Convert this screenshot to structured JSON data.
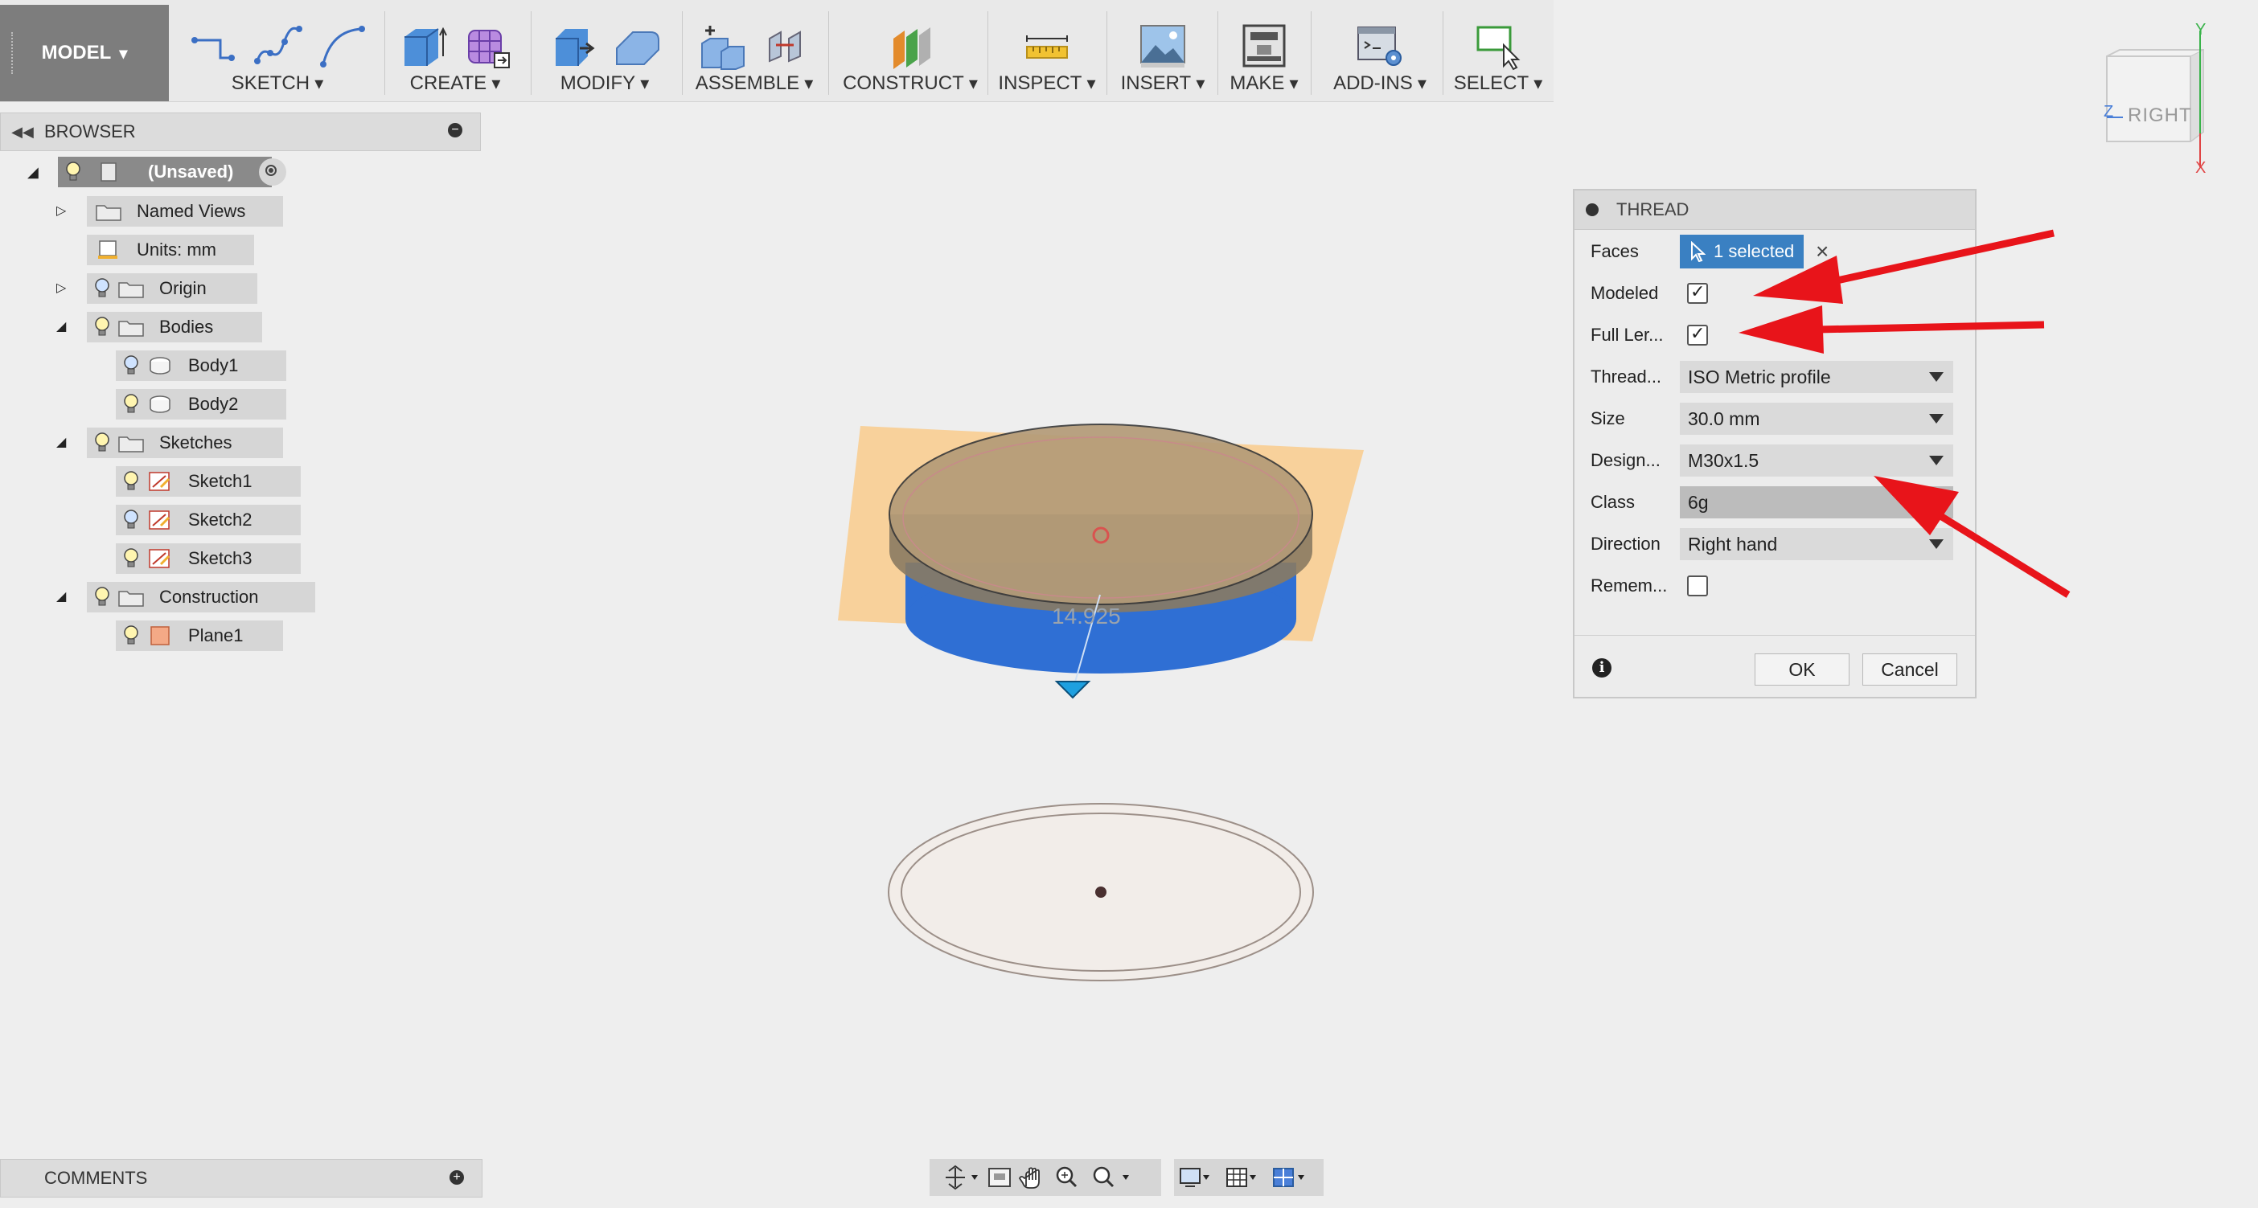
{
  "toolbar": {
    "workspace": "MODEL",
    "groups": [
      {
        "label": "SKETCH"
      },
      {
        "label": "CREATE"
      },
      {
        "label": "MODIFY"
      },
      {
        "label": "ASSEMBLE"
      },
      {
        "label": "CONSTRUCT"
      },
      {
        "label": "INSPECT"
      },
      {
        "label": "INSERT"
      },
      {
        "label": "MAKE"
      },
      {
        "label": "ADD-INS"
      },
      {
        "label": "SELECT"
      }
    ]
  },
  "browser": {
    "title": "BROWSER",
    "root": "(Unsaved)",
    "items": [
      {
        "label": "Named Views"
      },
      {
        "label": "Units: mm"
      },
      {
        "label": "Origin"
      },
      {
        "label": "Bodies"
      },
      {
        "label": "Body1"
      },
      {
        "label": "Body2"
      },
      {
        "label": "Sketches"
      },
      {
        "label": "Sketch1"
      },
      {
        "label": "Sketch2"
      },
      {
        "label": "Sketch3"
      },
      {
        "label": "Construction"
      },
      {
        "label": "Plane1"
      }
    ]
  },
  "comments": {
    "title": "COMMENTS"
  },
  "viewport": {
    "dimension_label": "14.925"
  },
  "viewcube": {
    "face": "RIGHT",
    "axis_y": "Y",
    "axis_z": "Z",
    "axis_x": "X"
  },
  "thread_dialog": {
    "title": "THREAD",
    "faces_label": "Faces",
    "faces_value": "1 selected",
    "modeled_label": "Modeled",
    "modeled_checked": true,
    "full_length_label": "Full Ler...",
    "full_length_checked": true,
    "thread_type_label": "Thread...",
    "thread_type_value": "ISO Metric profile",
    "size_label": "Size",
    "size_value": "30.0 mm",
    "designation_label": "Design...",
    "designation_value": "M30x1.5",
    "class_label": "Class",
    "class_value": "6g",
    "direction_label": "Direction",
    "direction_value": "Right hand",
    "remember_label": "Remem...",
    "remember_checked": false,
    "ok_label": "OK",
    "cancel_label": "Cancel"
  },
  "colors": {
    "selection_blue": "#3a80c2",
    "body_blue": "#2f6fd4",
    "plane_orange": "#f7c98a",
    "annotation_red": "#e8141a"
  }
}
